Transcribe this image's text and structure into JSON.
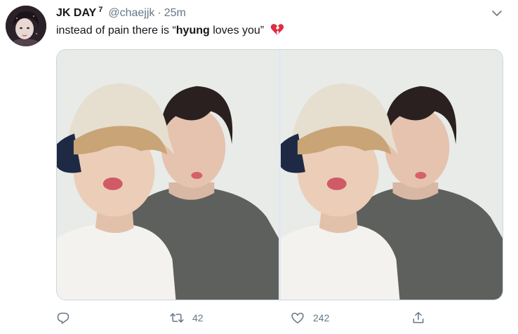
{
  "tweet": {
    "author": {
      "display_name": "JK DAY",
      "name_suffix": "7",
      "handle": "@chaejjk",
      "avatar_icon": "profile-photo"
    },
    "separator": "·",
    "time": "25m",
    "text": {
      "before": "instead of pain there is “",
      "bold": "hyung",
      "after": " loves you”",
      "emoji_icon": "broken-heart-emoji"
    },
    "media": {
      "photos": [
        {
          "icon": "photo-two-people"
        },
        {
          "icon": "photo-two-people"
        }
      ]
    },
    "actions": {
      "reply": {
        "icon": "reply-icon",
        "count": ""
      },
      "retweet": {
        "icon": "retweet-icon",
        "count": "42"
      },
      "like": {
        "icon": "heart-icon",
        "count": "242"
      },
      "share": {
        "icon": "share-icon",
        "count": ""
      }
    },
    "menu_icon": "chevron-down-icon"
  },
  "colors": {
    "text_primary": "#14171a",
    "text_secondary": "#657786",
    "border": "#ccd6dd",
    "emoji_red": "#dd2e44"
  }
}
